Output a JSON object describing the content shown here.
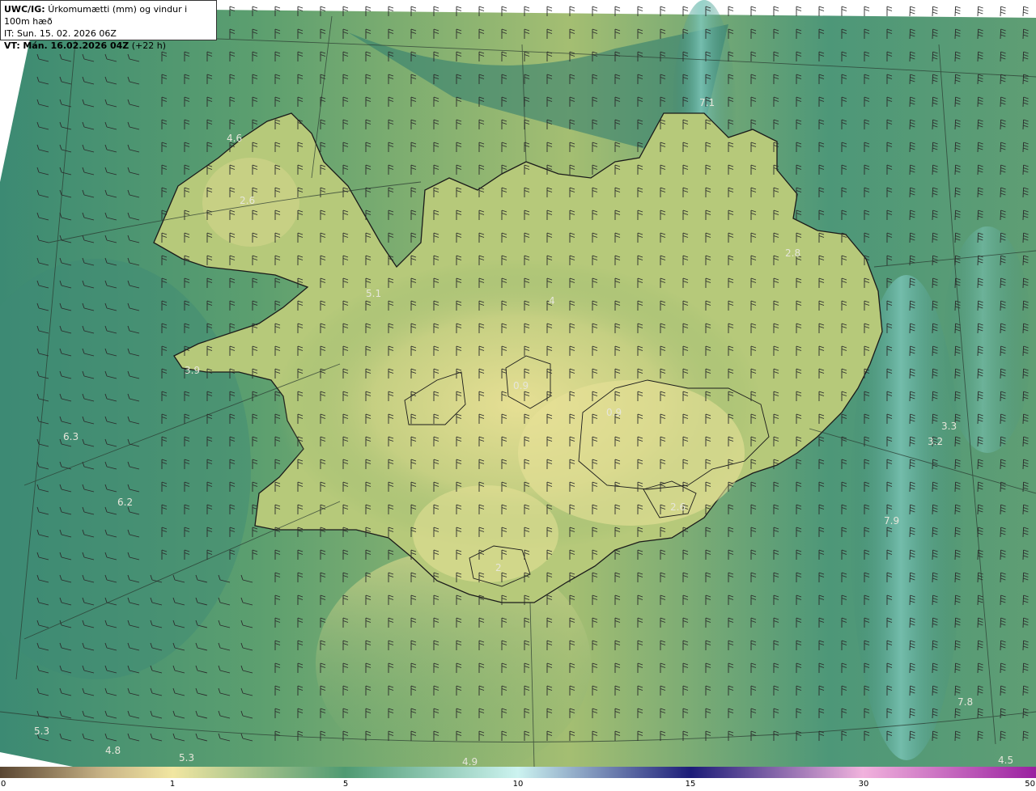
{
  "header": {
    "model": "UWC/IG:",
    "title": "Úrkomumætti (mm) og vindur i 100m hæð",
    "it_label": "IT:",
    "it_value": "Sun. 15. 02. 2026 06Z",
    "vt_label": "VT:",
    "vt_value": "Mán. 16.02.2026 04Z",
    "vt_lead": "(+22 h)"
  },
  "colors": {
    "sea_deep": "#2f7e72",
    "sea_mid": "#4f9a72",
    "land_low": "#9cbb6e",
    "land_high": "#e3df93",
    "cyan_band": "#7ec8bd",
    "coast": "#1a1a1a"
  },
  "map_values": [
    "4.6",
    "2.6",
    "5.1",
    "3.9",
    "7.1",
    "2.8",
    "4",
    "0.9",
    "0.9",
    "6.3",
    "6.2",
    "3.3",
    "3.2",
    "7.9",
    "2.6",
    "2",
    "7.8",
    "5.3",
    "4.8",
    "5.3",
    "4.9",
    "4.5"
  ],
  "colorbar": {
    "ticks": [
      "0",
      "1",
      "5",
      "10",
      "15",
      "30",
      "50"
    ],
    "stops": [
      "#5a4632",
      "#c9b487",
      "#f1e6a1",
      "#4f9a72",
      "#ccf3f0",
      "#1c1c78",
      "#f1b2dd",
      "#9a1fa0"
    ]
  }
}
